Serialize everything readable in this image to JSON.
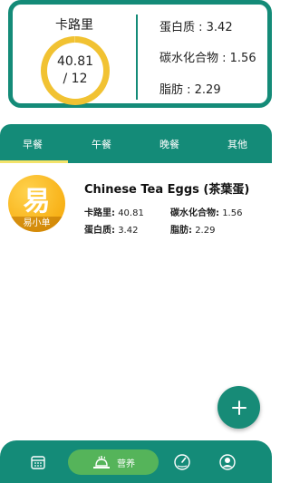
{
  "summary": {
    "calories_label": "卡路里",
    "calories_value": "40.81",
    "calories_goal": "/ 12",
    "protein": "蛋白质 : 3.42",
    "carbs": "碳水化合物 : 1.56",
    "fat": "脂肪 : 2.29"
  },
  "tabs": [
    {
      "label": "早餐",
      "selected": true
    },
    {
      "label": "午餐",
      "selected": false
    },
    {
      "label": "晚餐",
      "selected": false
    },
    {
      "label": "其他",
      "selected": false
    }
  ],
  "meal": {
    "logo_glyph": "易",
    "logo_text": "易小单",
    "name": "Chinese Tea Eggs (茶葉蛋)",
    "calories_label": "卡路里:",
    "calories_value": "40.81",
    "carbs_label": "碳水化合物:",
    "carbs_value": "1.56",
    "protein_label": "蛋白质:",
    "protein_value": "3.42",
    "fat_label": "脂肪:",
    "fat_value": "2.29"
  },
  "bottom_nav": {
    "items": [
      {
        "icon": "calendar-icon"
      },
      {
        "icon": "nutrition-icon",
        "label": "营养",
        "active": true
      },
      {
        "icon": "gauge-icon"
      },
      {
        "icon": "profile-icon"
      }
    ]
  },
  "colors": {
    "primary": "#148b78",
    "ring": "#f1c232",
    "active_pill": "#55b45a",
    "tab_underline": "#f3e36a"
  }
}
